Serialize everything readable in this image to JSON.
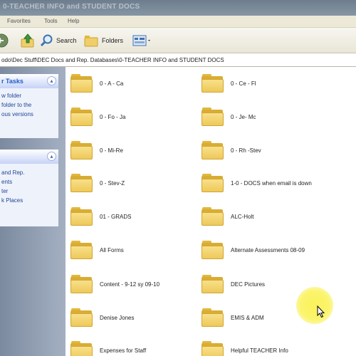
{
  "window": {
    "title": "0-TEACHER INFO and STUDENT DOCS"
  },
  "menubar": {
    "items": [
      "Favorites",
      "Tools",
      "Help"
    ]
  },
  "toolbar": {
    "search_label": "Search",
    "folders_label": "Folders"
  },
  "address": {
    "path": "odo\\Dec Stuff\\DEC Docs and Rep. Databases\\0-TEACHER INFO and STUDENT DOCS"
  },
  "sidebar": {
    "tasks_title": "r Tasks",
    "tasks": [
      "w folder",
      "folder to the",
      "",
      "ous versions"
    ],
    "places": [
      "and Rep.",
      "",
      "ents",
      "ter",
      "k Places"
    ]
  },
  "folders": {
    "left": [
      "0 - A - Ca",
      "0 - Fo - Ja",
      "0 - Mi-Re",
      "0 - Stev-Z",
      "01 - GRADS",
      "All Forms",
      "Content - 9-12 sy 09-10",
      "Denise Jones",
      "Expenses for Staff"
    ],
    "right": [
      "0 - Ce - Fl",
      "0 - Je- Mc",
      "0 - Rh -Stev",
      "1-0 - DOCS when email is down",
      "ALC-Holt",
      "Alternate Assessments 08-09",
      "DEC Pictures",
      "EMIS & ADM",
      "Helpful TEACHER Info"
    ]
  },
  "colors": {
    "folder_yellow": "#eec95a",
    "taskpane_blue": "#215dc6",
    "cursor_highlight": "#fbf25a"
  },
  "icons": [
    "back-icon",
    "up-folder-icon",
    "search-icon",
    "folders-icon",
    "views-icon",
    "collapse-icon",
    "folder-icon",
    "mouse-pointer-icon"
  ]
}
